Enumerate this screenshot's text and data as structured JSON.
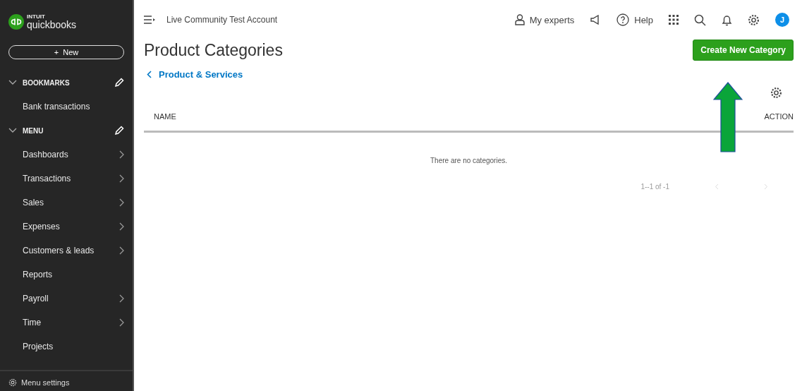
{
  "sidebar": {
    "logo": {
      "brand": "INTUIT",
      "product": "quickbooks"
    },
    "new_button": "+  New",
    "sections": [
      {
        "title": "BOOKMARKS",
        "expanded": true,
        "items": [
          {
            "label": "Bank transactions",
            "has_submenu": false
          }
        ]
      },
      {
        "title": "MENU",
        "expanded": true,
        "items": [
          {
            "label": "Dashboards",
            "has_submenu": true
          },
          {
            "label": "Transactions",
            "has_submenu": true
          },
          {
            "label": "Sales",
            "has_submenu": true
          },
          {
            "label": "Expenses",
            "has_submenu": true
          },
          {
            "label": "Customers & leads",
            "has_submenu": true
          },
          {
            "label": "Reports",
            "has_submenu": false
          },
          {
            "label": "Payroll",
            "has_submenu": true
          },
          {
            "label": "Time",
            "has_submenu": true
          },
          {
            "label": "Projects",
            "has_submenu": false
          }
        ]
      }
    ],
    "footer": "Menu settings"
  },
  "header": {
    "account": "Live Community Test Account",
    "my_experts": "My experts",
    "help": "Help",
    "avatar": "J"
  },
  "page": {
    "title": "Product Categories",
    "back_link": "Product & Services",
    "create_button": "Create New Category"
  },
  "table": {
    "columns": [
      "NAME",
      "ACTION"
    ],
    "empty_message": "There are no categories.",
    "pagination": "1--1 of -1"
  }
}
